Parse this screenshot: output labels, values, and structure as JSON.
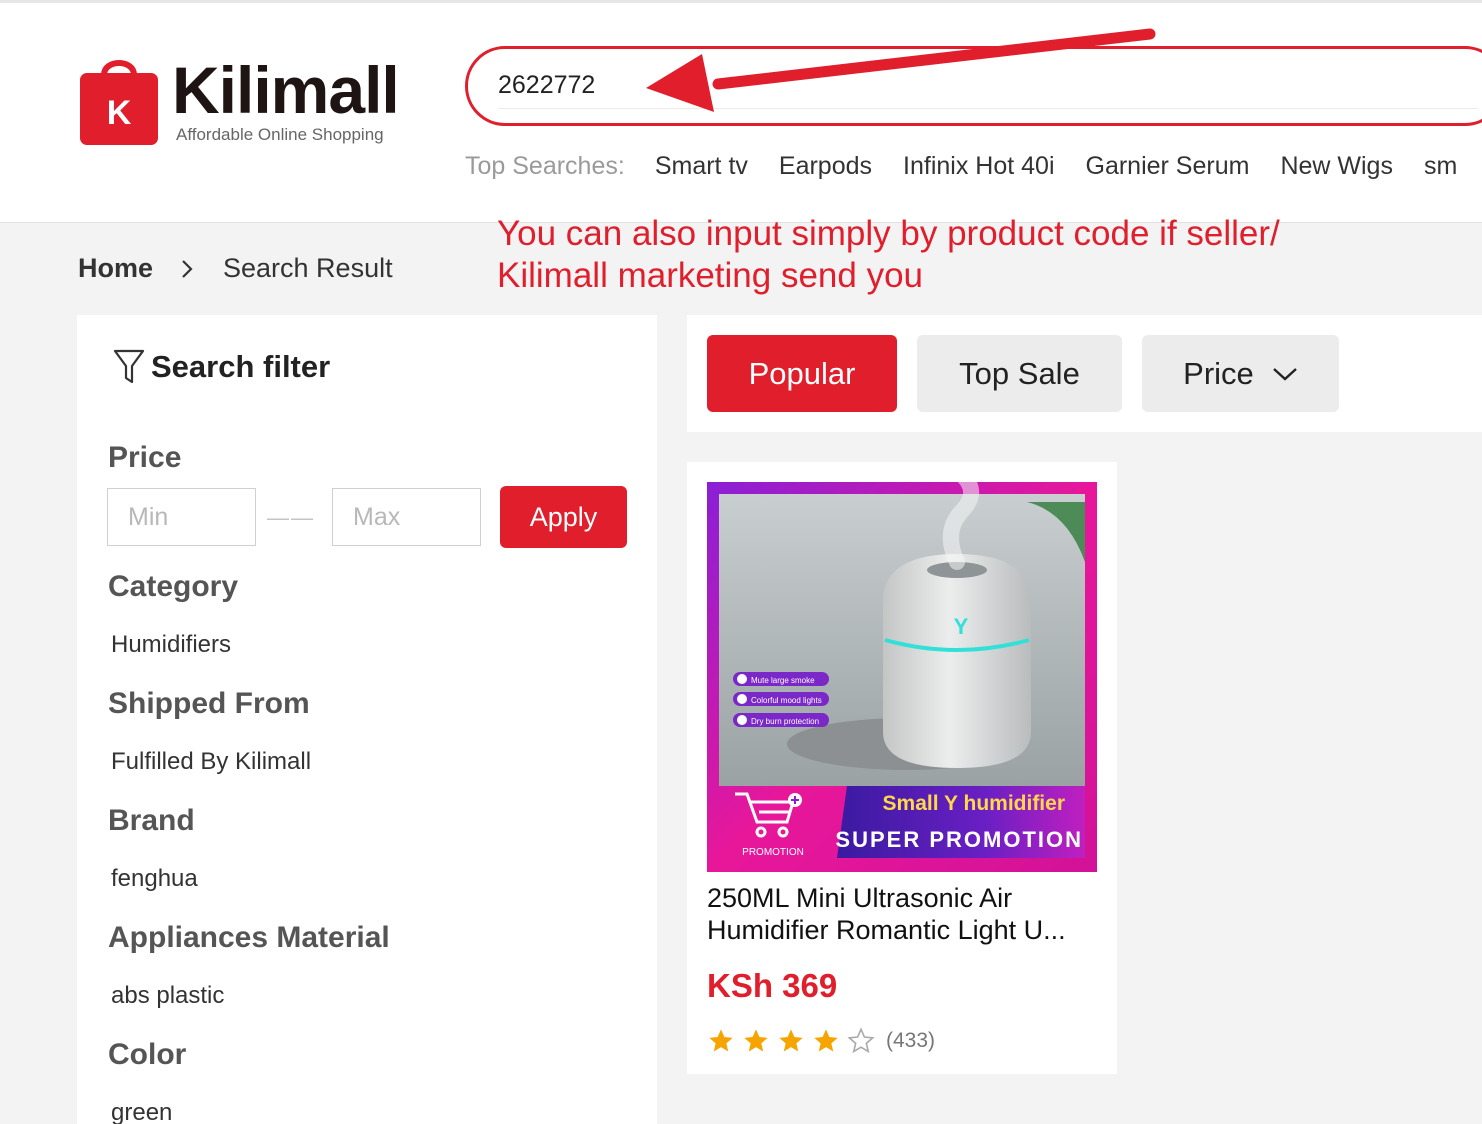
{
  "brand": {
    "name": "Kilimall",
    "tagline": "Affordable Online Shopping",
    "logo_letter": "K",
    "color": "#e01e2c"
  },
  "search": {
    "value": "2622772"
  },
  "top_searches": {
    "label": "Top Searches:",
    "items": [
      "Smart tv",
      "Earpods",
      "Infinix Hot 40i",
      "Garnier Serum",
      "New Wigs",
      "sm"
    ]
  },
  "breadcrumb": {
    "home": "Home",
    "current": "Search Result"
  },
  "annotation": {
    "line1": "You can also input simply by product code if seller/",
    "line2": "Kilimall marketing send you",
    "color": "#e01e2c"
  },
  "filter": {
    "title": "Search filter",
    "price": {
      "heading": "Price",
      "min_placeholder": "Min",
      "max_placeholder": "Max",
      "separator": "——",
      "apply": "Apply"
    },
    "sections": [
      {
        "heading": "Category",
        "value": "Humidifiers"
      },
      {
        "heading": "Shipped From",
        "value": "Fulfilled By Kilimall"
      },
      {
        "heading": "Brand",
        "value": "fenghua"
      },
      {
        "heading": "Appliances Material",
        "value": "abs plastic"
      },
      {
        "heading": "Color",
        "value": "green"
      }
    ]
  },
  "sort": {
    "popular": "Popular",
    "top_sale": "Top Sale",
    "price": "Price",
    "active": "Popular"
  },
  "product": {
    "title_line1": "250ML Mini Ultrasonic Air",
    "title_line2": "Humidifier Romantic Light U...",
    "price": "KSh 369",
    "rating_stars": 4,
    "rating_max": 5,
    "review_count": "(433)",
    "image": {
      "features": [
        "Mute large smoke",
        "Colorful mood lights",
        "Dry burn protection"
      ],
      "banner_title": "Small Y humidifier",
      "banner_subtitle": "SUPER PROMOTION",
      "badge": "PROMOTION"
    }
  }
}
